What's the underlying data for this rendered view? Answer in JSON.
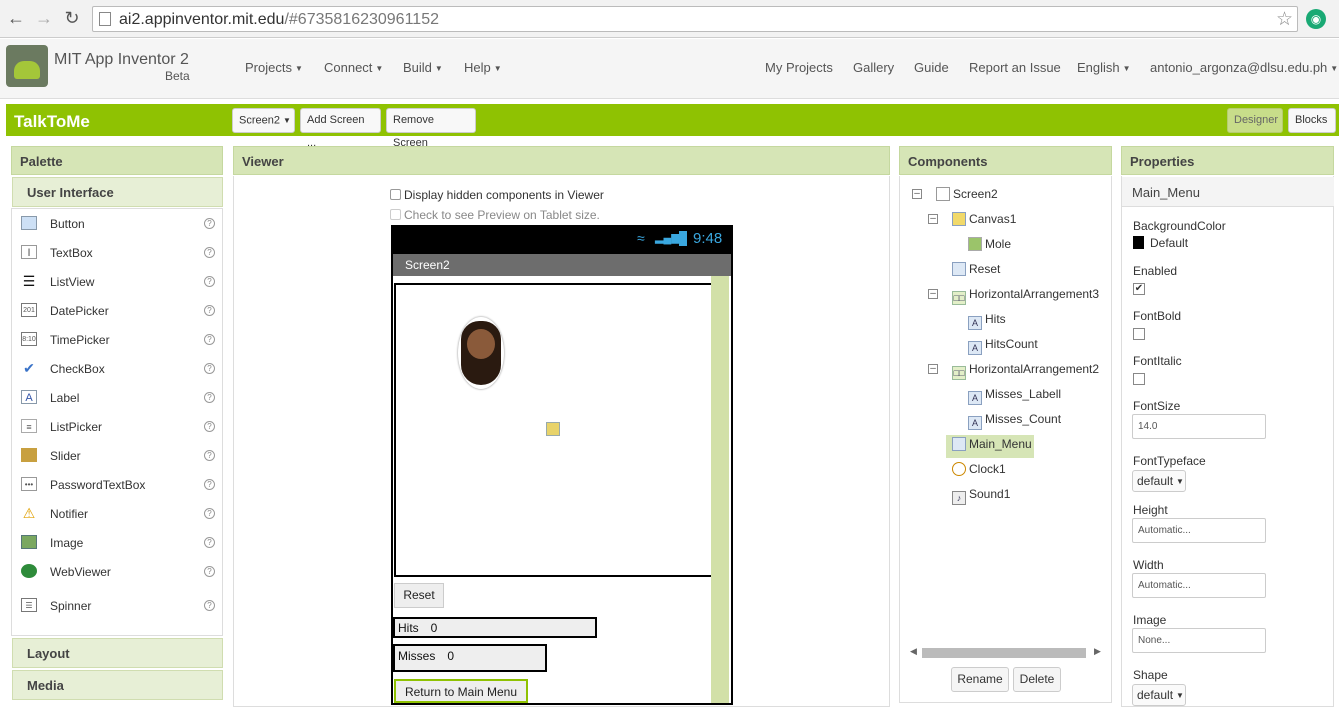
{
  "browser": {
    "url_host": "ai2.appinventor.mit.edu",
    "url_path": "/#6735816230961152"
  },
  "header": {
    "brand": "MIT App Inventor 2",
    "beta": "Beta",
    "menus": [
      "Projects",
      "Connect",
      "Build",
      "Help"
    ],
    "links": [
      "My Projects",
      "Gallery",
      "Guide",
      "Report an Issue"
    ],
    "language": "English",
    "user": "antonio_argonza@dlsu.edu.ph"
  },
  "toolbar": {
    "project_name": "TalkToMe",
    "screen_select": "Screen2",
    "add_screen": "Add Screen ...",
    "remove_screen": "Remove Screen",
    "designer": "Designer",
    "blocks": "Blocks"
  },
  "palette": {
    "title": "Palette",
    "section_user_interface": "User Interface",
    "items": [
      "Button",
      "TextBox",
      "ListView",
      "DatePicker",
      "TimePicker",
      "CheckBox",
      "Label",
      "ListPicker",
      "Slider",
      "PasswordTextBox",
      "Notifier",
      "Image",
      "WebViewer",
      "Spinner"
    ],
    "section_layout": "Layout",
    "section_media": "Media"
  },
  "viewer": {
    "title": "Viewer",
    "show_hidden": "Display hidden components in Viewer",
    "tablet_preview": "Check to see Preview on Tablet size.",
    "time": "9:48",
    "screen_title": "Screen2",
    "reset_button": "Reset",
    "hits_label": "Hits",
    "hits_count": "0",
    "misses_label": "Misses",
    "misses_count": "0",
    "main_menu_button": "Return to Main Menu"
  },
  "components": {
    "title": "Components",
    "tree": {
      "screen": "Screen2",
      "canvas": "Canvas1",
      "mole": "Mole",
      "reset": "Reset",
      "harr3": "HorizontalArrangement3",
      "hits": "Hits",
      "hits_count": "HitsCount",
      "harr2": "HorizontalArrangement2",
      "misses_label": "Misses_Labell",
      "misses_count": "Misses_Count",
      "main_menu": "Main_Menu",
      "clock": "Clock1",
      "sound": "Sound1"
    },
    "rename": "Rename",
    "delete": "Delete"
  },
  "properties": {
    "title": "Properties",
    "component": "Main_Menu",
    "background_color_label": "BackgroundColor",
    "background_color_value": "Default",
    "enabled_label": "Enabled",
    "enabled": true,
    "fontbold_label": "FontBold",
    "fontbold": false,
    "fontitalic_label": "FontItalic",
    "fontitalic": false,
    "fontsize_label": "FontSize",
    "fontsize_value": "14.0",
    "fonttypeface_label": "FontTypeface",
    "fonttypeface_value": "default",
    "height_label": "Height",
    "height_value": "Automatic...",
    "width_label": "Width",
    "width_value": "Automatic...",
    "image_label": "Image",
    "image_value": "None...",
    "shape_label": "Shape",
    "shape_value": "default"
  },
  "colors": {
    "accent_green": "#8fc202",
    "panel_head": "#d6e5b6"
  }
}
